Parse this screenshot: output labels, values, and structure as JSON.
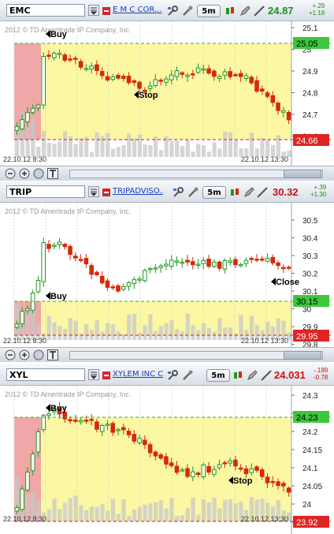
{
  "panels": [
    {
      "symbol": "EMC",
      "name": "E M C COR...",
      "interval": "5m",
      "last": "24.87",
      "change_top": "+.29",
      "change_bottom": "+1.18",
      "last_color": "#1a8f1a",
      "copyright": "2012 © TD Ameritrade IP Company, Inc.",
      "yticks": [
        "25.1",
        "25",
        "24.9",
        "24.8",
        "24.7",
        "24.6"
      ],
      "upper_label": "25.05",
      "lower_label": "24.66",
      "markers": [
        {
          "text": "Buy"
        },
        {
          "text": "Stop"
        }
      ],
      "date_start": "22.10.12 8:30",
      "date_end": "22.10.12 13:30"
    },
    {
      "symbol": "TRIP",
      "name": "TRIPADVISO...",
      "interval": "5m",
      "last": "30.32",
      "change_top": "+.39",
      "change_bottom": "+1.30",
      "last_color": "#cc1111",
      "copyright": "2012 © TD Ameritrade IP Company, Inc.",
      "yticks": [
        "30.5",
        "30.4",
        "30.3",
        "30.2",
        "30.1",
        "30",
        "29.9",
        "29.8"
      ],
      "upper_label": "30.15",
      "lower_label": "29.95",
      "markers": [
        {
          "text": "Buy"
        },
        {
          "text": "Close"
        }
      ],
      "date_start": "22.10.12 8:30",
      "date_end": "22.10.12 13:30"
    },
    {
      "symbol": "XYL",
      "name": "XYLEM INC C...",
      "interval": "5m",
      "last": "24.031",
      "change_top": "-.189",
      "change_bottom": "-0.78",
      "last_color": "#cc1111",
      "copyright": "2012 © TD Ameritrade IP Company, Inc.",
      "yticks": [
        "24.3",
        "24.25",
        "24.2",
        "24.15",
        "24.1",
        "24.05",
        "24",
        "23.95"
      ],
      "upper_label": "24.23",
      "lower_label": "23.92",
      "markers": [
        {
          "text": "Buy"
        },
        {
          "text": "Stop"
        }
      ],
      "date_start": "22.10.12 8:30",
      "date_end": "22.10.12 13:30"
    }
  ],
  "colors": {
    "up": "#1f9a1f",
    "down": "#d42a0a",
    "band": "#fbf7a3",
    "entry_zone": "#f0a7a7",
    "upper_line": "#2db32d",
    "lower_line": "#d41a1a"
  }
}
